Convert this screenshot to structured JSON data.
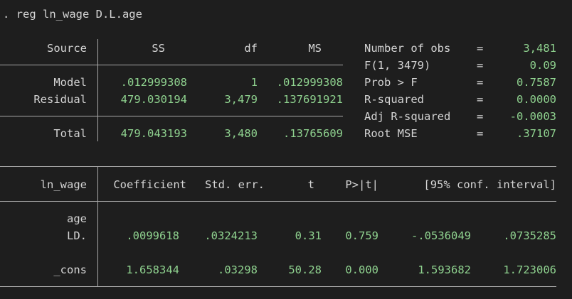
{
  "command": ". reg ln_wage D.L.age",
  "anova": {
    "headers": {
      "source": "Source",
      "ss": "SS",
      "df": "df",
      "ms": "MS"
    },
    "rows": [
      {
        "source": "Model",
        "ss": ".012999308",
        "df": "1",
        "ms": ".012999308"
      },
      {
        "source": "Residual",
        "ss": "479.030194",
        "df": "3,479",
        "ms": ".137691921"
      },
      {
        "source": "Total",
        "ss": "479.043193",
        "df": "3,480",
        "ms": ".13765609"
      }
    ]
  },
  "stats": [
    {
      "label": "Number of obs",
      "eq": "=",
      "value": "3,481"
    },
    {
      "label": "F(1, 3479)",
      "eq": "=",
      "value": "0.09"
    },
    {
      "label": "Prob > F",
      "eq": "=",
      "value": "0.7587"
    },
    {
      "label": "R-squared",
      "eq": "=",
      "value": "0.0000"
    },
    {
      "label": "Adj R-squared",
      "eq": "=",
      "value": "-0.0003"
    },
    {
      "label": "Root MSE",
      "eq": "=",
      "value": ".37107"
    }
  ],
  "coef": {
    "headers": {
      "var": "ln_wage",
      "coef": "Coefficient",
      "se": "Std. err.",
      "t": "t",
      "p": "P>|t|",
      "ci": "[95% conf. interval]"
    },
    "group_label": "age",
    "rows": [
      {
        "var": "LD.",
        "coef": ".0099618",
        "se": ".0324213",
        "t": "0.31",
        "p": "0.759",
        "lo": "-.0536049",
        "hi": ".0735285"
      },
      {
        "var": "_cons",
        "coef": "1.658344",
        "se": ".03298",
        "t": "50.28",
        "p": "0.000",
        "lo": "1.593682",
        "hi": "1.723006"
      }
    ]
  }
}
